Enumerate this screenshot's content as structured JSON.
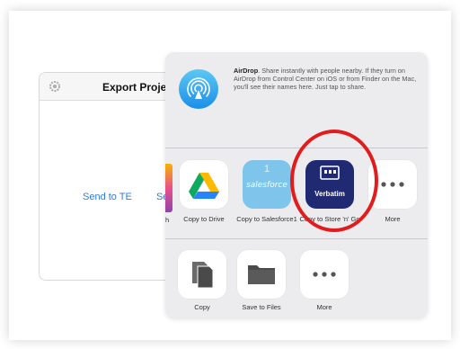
{
  "export_dialog": {
    "title": "Export Proje",
    "send_button": "Send to TE",
    "peek_text": "Se"
  },
  "share_sheet": {
    "airdrop": {
      "title": "AirDrop",
      "description": ". Share instantly with people nearby. If they turn on AirDrop from Control Center on iOS or from Finder on the Mac, you'll see their names here. Just tap to share."
    },
    "apps_row": {
      "peek_label": "h",
      "items": [
        {
          "label": "Copy to Drive"
        },
        {
          "label": "Copy to Salesforce1"
        },
        {
          "label": "Copy to Store 'n' Go"
        },
        {
          "label": "More"
        }
      ],
      "salesforce_logo_text": "salesforce",
      "salesforce_number": "1",
      "verbatim_logo_text": "Verbatim"
    },
    "actions_row": {
      "items": [
        {
          "label": "Copy"
        },
        {
          "label": "Save to Files"
        },
        {
          "label": "More"
        }
      ]
    }
  },
  "colors": {
    "accent_blue": "#2f7cd8",
    "highlight_ring": "#e21c1c",
    "verbatim_bg": "#1f2a72",
    "salesforce_bg": "#7fc4ea"
  }
}
